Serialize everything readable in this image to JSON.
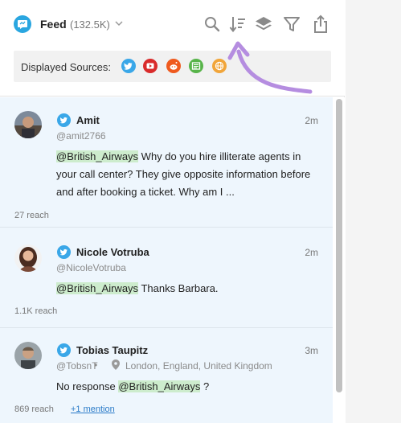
{
  "header": {
    "title": "Feed",
    "count": "(132.5K)",
    "sources_label": "Displayed Sources:"
  },
  "sources": [
    {
      "name": "twitter",
      "color": "#3aa7e8"
    },
    {
      "name": "youtube",
      "color": "#d92b2b"
    },
    {
      "name": "reddit",
      "color": "#ef5a1e"
    },
    {
      "name": "news",
      "color": "#58b44a"
    },
    {
      "name": "web",
      "color": "#f1a53a"
    }
  ],
  "colors": {
    "accent": "#2aa6e0",
    "annotation_arrow": "#b58de0",
    "highlight": "#cdeccd",
    "feed_background": "#eef6fd"
  },
  "posts": [
    {
      "name": "Amit",
      "handle": "@amit2766",
      "time": "2m",
      "mention": "@British_Airways",
      "text_after": " Why do you hire illiterate agents in",
      "line2": "your call center? They give opposite information before",
      "line3": "and after booking a ticket. Why am I ...",
      "reach": "27 reach"
    },
    {
      "name": "Nicole Votruba",
      "handle": "@NicoleVotruba",
      "time": "2m",
      "mention": "@British_Airways",
      "text_after": " Thanks Barbara.",
      "reach": "1.1K reach"
    },
    {
      "name": "Tobias Taupitz",
      "handle": "@TobsnT",
      "time": "3m",
      "location": "London, England, United Kingdom",
      "text_before": "No response ",
      "mention": "@British_Airways",
      "text_after": " ?",
      "reach": "869 reach",
      "mentions_link": "+1 mention"
    }
  ]
}
